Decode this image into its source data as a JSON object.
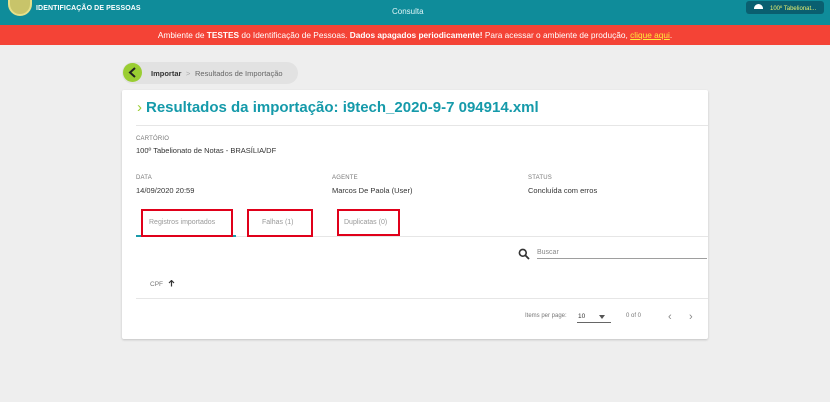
{
  "header": {
    "app_name": "IDENTIFICAÇÃO DE PESSOAS",
    "nav_center": "Consulta",
    "user_chip": "100º Tabelionat..."
  },
  "banner": {
    "text_1": "Ambiente de ",
    "bold_1": "TESTES",
    "text_2": " do Identificação de Pessoas. ",
    "bold_2": "Dados apagados periodicamente!",
    "text_3": " Para acessar o ambiente de produção, ",
    "link": "clique aqui",
    "text_4": "."
  },
  "breadcrumb": {
    "parent": "Importar",
    "separator": ">",
    "current": "Resultados de Importação"
  },
  "title": {
    "arrow": "›",
    "text": "Resultados da importação: i9tech_2020-9-7 094914.xml"
  },
  "details": {
    "cartorio_label": "CARTÓRIO",
    "cartorio_value": "100º Tabelionato de Notas - BRASÍLIA/DF",
    "data_label": "DATA",
    "data_value": "14/09/2020 20:59",
    "agente_label": "AGENTE",
    "agente_value": "Marcos De Paola (User)",
    "status_label": "STATUS",
    "status_value": "Concluída com erros"
  },
  "tabs": [
    {
      "label": "Registros importados"
    },
    {
      "label": "Falhas (1)"
    },
    {
      "label": "Duplicatas (0)"
    }
  ],
  "search": {
    "placeholder": "Buscar",
    "value": ""
  },
  "table": {
    "col_cpf": "CPF",
    "sort_icon": "arrow-up-icon"
  },
  "pagination": {
    "items_per_page_label": "Items per page:",
    "items_per_page_value": "10",
    "range": "0 of 0",
    "prev": "‹",
    "next": "›"
  },
  "colors": {
    "header": "#0f8c9a",
    "banner": "#f44336",
    "accent": "#159aaa",
    "green": "#9acd32",
    "highlight": "#e0001a"
  }
}
